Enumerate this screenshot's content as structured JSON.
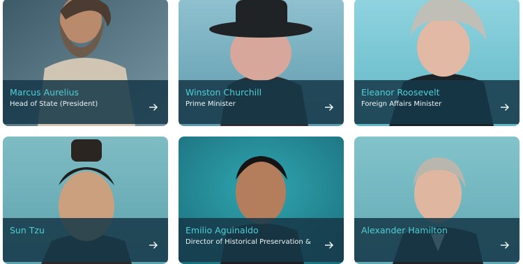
{
  "cards": [
    {
      "name": "Marcus Aurelius",
      "role": "Head of State (President)",
      "arrow_icon": "arrow-right-icon"
    },
    {
      "name": "Winston Churchill",
      "role": "Prime Minister",
      "arrow_icon": "arrow-right-icon"
    },
    {
      "name": "Eleanor Roosevelt",
      "role": "Foreign Affairs Minister",
      "arrow_icon": "arrow-right-icon"
    },
    {
      "name": "Sun Tzu",
      "role": "",
      "arrow_icon": "arrow-right-icon"
    },
    {
      "name": "Emilio Aguinaldo",
      "role": "Director of Historical Preservation &",
      "arrow_icon": "arrow-right-icon"
    },
    {
      "name": "Alexander Hamilton",
      "role": "",
      "arrow_icon": "arrow-right-icon"
    }
  ],
  "colors": {
    "caption_bg": "#163848",
    "name_text": "#4fd0d6",
    "role_text": "#eef6f8"
  }
}
